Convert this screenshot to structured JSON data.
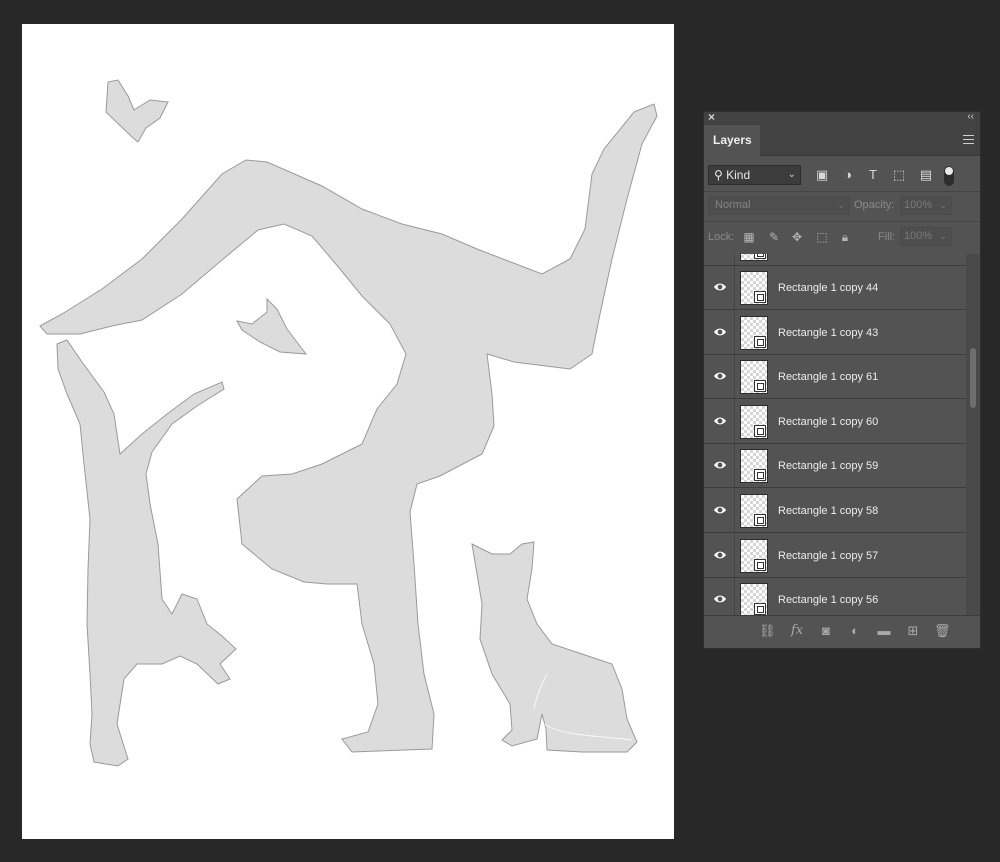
{
  "panel": {
    "title": "Layers",
    "filter": {
      "kind_label": "Kind"
    },
    "blend_mode": "Normal",
    "opacity_label": "Opacity:",
    "opacity_value": "100%",
    "lock_label": "Lock:",
    "fill_label": "Fill:",
    "fill_value": "100%",
    "layers": [
      {
        "name": "Rectangle 1 copy 44",
        "visible": true
      },
      {
        "name": "Rectangle 1 copy 43",
        "visible": true
      },
      {
        "name": "Rectangle 1 copy 61",
        "visible": true
      },
      {
        "name": "Rectangle 1 copy 60",
        "visible": true
      },
      {
        "name": "Rectangle 1 copy 59",
        "visible": true
      },
      {
        "name": "Rectangle 1 copy 58",
        "visible": true
      },
      {
        "name": "Rectangle 1 copy 57",
        "visible": true
      },
      {
        "name": "Rectangle 1 copy 56",
        "visible": true
      }
    ]
  },
  "canvas": {
    "fill_color": "#dcdcdc",
    "stroke_color": "#9a9a9a",
    "background": "#ffffff"
  },
  "icons": [
    "search-icon",
    "image-filter-icon",
    "adjustment-filter-icon",
    "type-filter-icon",
    "shape-filter-icon",
    "smart-object-filter-icon",
    "filter-toggle-icon",
    "lock-pixels-icon",
    "lock-brush-icon",
    "lock-position-icon",
    "lock-artboard-icon",
    "lock-all-icon",
    "eye-icon",
    "link-icon",
    "fx-icon",
    "mask-icon",
    "adjustment-layer-icon",
    "folder-icon",
    "new-layer-icon",
    "trash-icon"
  ]
}
